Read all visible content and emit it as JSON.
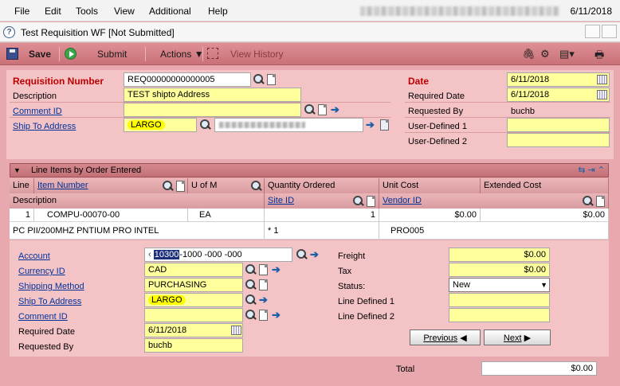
{
  "menu": {
    "items": [
      "File",
      "Edit",
      "Tools",
      "View",
      "Additional",
      "Help"
    ],
    "date": "6/11/2018"
  },
  "window": {
    "title": "Test Requisition WF [Not Submitted]"
  },
  "toolbar": {
    "save": "Save",
    "submit": "Submit",
    "actions": "Actions",
    "view_history": "View History"
  },
  "header": {
    "req_number_label": "Requisition Number",
    "req_number": "REQ00000000000005",
    "description_label": "Description",
    "description": "TEST shipto Address",
    "comment_label": "Comment ID",
    "comment": "",
    "ship_to_label": "Ship To Address",
    "ship_to": "LARGO",
    "date_label": "Date",
    "date": "6/11/2018",
    "required_date_label": "Required Date",
    "required_date": "6/11/2018",
    "requested_by_label": "Requested By",
    "requested_by": "buchb",
    "ud1_label": "User-Defined 1",
    "ud1": "",
    "ud2_label": "User-Defined 2",
    "ud2": ""
  },
  "grid": {
    "title": "Line Items by Order Entered",
    "cols": {
      "line": "Line",
      "item": "Item Number",
      "uom": "U of M",
      "qty": "Quantity Ordered",
      "unit_cost": "Unit Cost",
      "ext_cost": "Extended Cost",
      "desc": "Description",
      "site": "Site ID",
      "vendor": "Vendor ID"
    },
    "row": {
      "line": "1",
      "item": "COMPU-00070-00",
      "uom": "EA",
      "qty": "1",
      "unit_cost": "$0.00",
      "ext_cost": "$0.00",
      "desc": "PC PII/200MHZ PNTIUM PRO INTEL",
      "site": "* 1",
      "vendor": "PRO005"
    }
  },
  "detail": {
    "account_label": "Account",
    "account_first": "10300",
    "account_rest": "-1000 -000 -000",
    "currency_label": "Currency ID",
    "currency": "CAD",
    "shipping_label": "Shipping Method",
    "shipping": "PURCHASING",
    "shipto_label": "Ship To Address",
    "shipto": "LARGO",
    "comment_label": "Comment ID",
    "comment": "",
    "required_date_label": "Required Date",
    "required_date": "6/11/2018",
    "requested_by_label": "Requested By",
    "requested_by": "buchb",
    "freight_label": "Freight",
    "freight": "$0.00",
    "tax_label": "Tax",
    "tax": "$0.00",
    "status_label": "Status:",
    "status": "New",
    "ld1_label": "Line Defined 1",
    "ld1": "",
    "ld2_label": "Line Defined 2",
    "ld2": "",
    "previous": "Previous",
    "next": "Next"
  },
  "footer": {
    "total_label": "Total",
    "total": "$0.00"
  },
  "colors": {
    "section_bg": "#f4c3c6",
    "toolbar": "#d0797f",
    "field": "#ffff9c",
    "required_label": "#c00000",
    "link": "#00339a",
    "highlight": "#ffff00"
  }
}
